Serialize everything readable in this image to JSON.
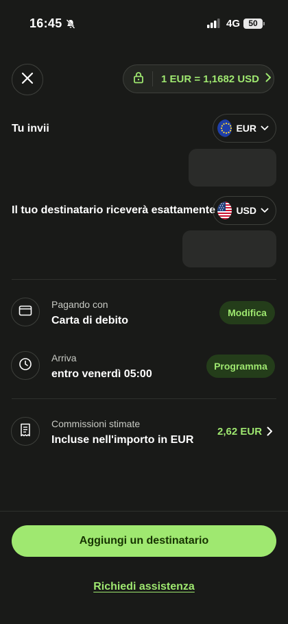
{
  "status_bar": {
    "time": "16:45",
    "network": "4G",
    "battery": "50"
  },
  "header": {
    "close_icon": "close-icon",
    "rate_text": "1 EUR = 1,1682 USD",
    "lock_icon": "lock-icon"
  },
  "send": {
    "label": "Tu invii",
    "currency": "EUR",
    "flag": "eu-flag-icon"
  },
  "receive": {
    "label": "Il tuo destinatario riceverà esattamente",
    "currency": "USD",
    "flag": "us-flag-icon"
  },
  "details": [
    {
      "icon": "card-icon",
      "subtitle": "Pagando con",
      "title": "Carta di debito",
      "action": "Modifica"
    },
    {
      "icon": "clock-icon",
      "subtitle": "Arriva",
      "title": "entro venerdì 05:00",
      "action": "Programma"
    },
    {
      "icon": "receipt-icon",
      "subtitle": "Commissioni stimate",
      "title": "Incluse nell'importo in EUR",
      "amount": "2,62 EUR"
    }
  ],
  "footer": {
    "primary_button": "Aggiungi un destinatario",
    "help_link": "Richiedi assistenza"
  },
  "colors": {
    "background": "#191a18",
    "accent": "#9fe870",
    "accent_dark": "#163300"
  }
}
